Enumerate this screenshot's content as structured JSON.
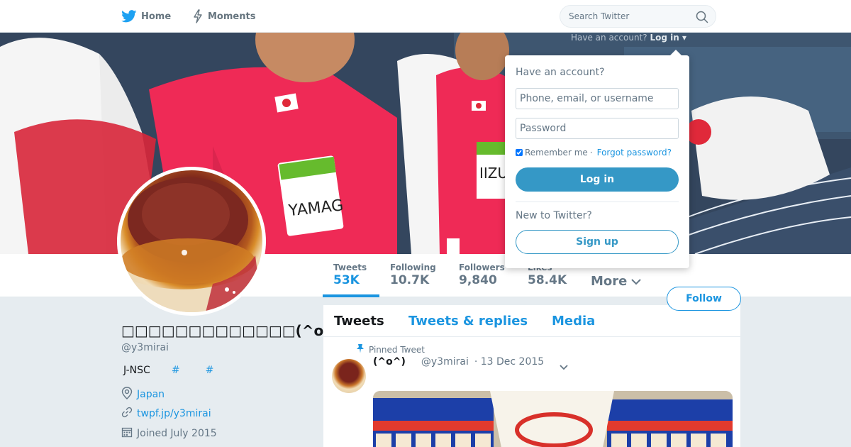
{
  "nav": {
    "home_label": "Home",
    "moments_label": "Moments",
    "search_placeholder": "Search Twitter"
  },
  "login_prompt": {
    "text": "Have an account?",
    "link": "Log in"
  },
  "login_dropdown": {
    "title": "Have an account?",
    "username_placeholder": "Phone, email, or username",
    "password_placeholder": "Password",
    "remember_label": "Remember me",
    "separator": "·",
    "forgot_label": "Forgot password?",
    "login_button": "Log in",
    "new_label": "New to Twitter?",
    "signup_button": "Sign up"
  },
  "stats": [
    {
      "label": "Tweets",
      "value": "53K"
    },
    {
      "label": "Following",
      "value": "10.7K"
    },
    {
      "label": "Followers",
      "value": "9,840"
    },
    {
      "label": "Likes",
      "value": "58.4K"
    }
  ],
  "more_label": "More",
  "follow_label": "Follow",
  "profile": {
    "name": "□□□□□□□□□□□□□(^o^)",
    "handle": "@y3mirai",
    "bio_text": "J-NSC",
    "bio_tags": [
      "#",
      "#"
    ],
    "location": "Japan",
    "website": "twpf.jp/y3mirai",
    "joined": "Joined July 2015"
  },
  "timeline": {
    "tabs": [
      "Tweets",
      "Tweets & replies",
      "Media"
    ],
    "pinned_label": "Pinned Tweet",
    "tweet": {
      "name": "(^o^)",
      "handle": "@y3mirai",
      "date": "· 13 Dec 2015"
    }
  },
  "colors": {
    "accent": "#1b95e0",
    "login_button": "#3598c6",
    "background": "#e6ecf0"
  },
  "icons": {
    "home": "twitter-bird-icon",
    "moments": "lightning-icon",
    "search": "search-icon",
    "pin": "pin-icon",
    "location": "location-pin-icon",
    "link": "link-icon",
    "calendar": "calendar-icon"
  }
}
